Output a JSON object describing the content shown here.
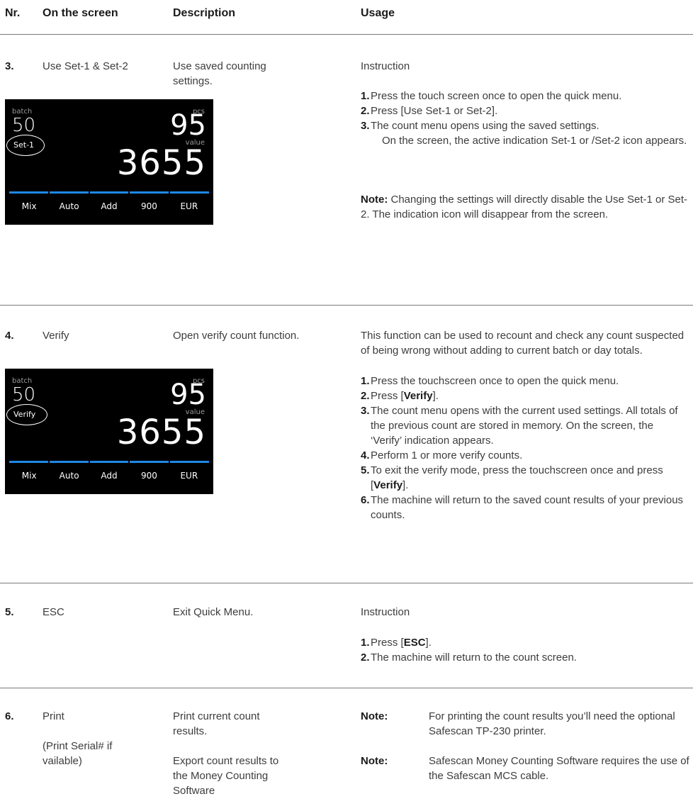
{
  "headers": {
    "nr": "Nr.",
    "screen": "On the screen",
    "description": "Description",
    "usage": "Usage"
  },
  "rows": [
    {
      "nr": "3.",
      "screen_name": "Use Set-1 & Set-2",
      "description": "Use saved counting settings.",
      "usage_title": "Instruction",
      "steps": [
        {
          "n": "1.",
          "text": "Press the touch screen once to open the quick menu."
        },
        {
          "n": "2.",
          "text": "Press [Use Set-1 or Set-2]."
        },
        {
          "n": "3.",
          "text_a": "The count menu opens using the saved settings.",
          "text_b": "On the screen, the active indication Set-1 or /Set-2 icon appears."
        }
      ],
      "note_label": "Note:",
      "note_text": "Changing the settings will directly disable the Use Set-1 or Set-2. The indication icon will disappear from the screen.",
      "display": {
        "batch_label": "batch",
        "batch": "50",
        "pcs_label": "pcs",
        "pcs": "95",
        "value_label": "value",
        "value": "3655",
        "indicator": "Set-1",
        "tabs": [
          "Mix",
          "Auto",
          "Add",
          "900",
          "EUR"
        ]
      }
    },
    {
      "nr": "4.",
      "screen_name": "Verify",
      "description": "Open verify count function.",
      "intro": "This function can be used to recount and check any count suspected of being wrong without adding to current batch or day totals.",
      "steps": [
        {
          "n": "1.",
          "text": "Press the touchscreen once to open the quick menu."
        },
        {
          "n": "2.",
          "pre": "Press [",
          "bold": "Verify",
          "post": "]."
        },
        {
          "n": "3.",
          "text": "The count menu opens with the current used settings. All totals of the previous count are stored in memory. On the screen, the ‘Verify’ indication appears."
        },
        {
          "n": "4.",
          "text": "Perform 1 or more verify counts."
        },
        {
          "n": "5.",
          "pre": "To exit the verify mode, press the touchscreen once and press [",
          "bold": "Verify",
          "post": "]."
        },
        {
          "n": "6.",
          "text": "The machine will return to the saved count results of your previous counts."
        }
      ],
      "display": {
        "batch_label": "batch",
        "batch": "50",
        "pcs_label": "pcs",
        "pcs": "95",
        "value_label": "value",
        "value": "3655",
        "indicator": "Verify",
        "tabs": [
          "Mix",
          "Auto",
          "Add",
          "900",
          "EUR"
        ]
      }
    },
    {
      "nr": "5.",
      "screen_name": "ESC",
      "description": "Exit Quick Menu.",
      "usage_title": "Instruction",
      "steps": [
        {
          "n": "1.",
          "pre": "Press [",
          "bold": "ESC",
          "post": "]."
        },
        {
          "n": "2.",
          "text": "The machine will return to the count screen."
        }
      ]
    },
    {
      "nr": "6.",
      "screen_name": "Print",
      "screen_sub": "(Print Serial# if vailable)",
      "description": "Print current count results.",
      "description_2": "Export count results to the Money Counting Software",
      "notes": [
        {
          "label": "Note:",
          "text": "For printing the count results you’ll need the optional Safescan TP-230 printer."
        },
        {
          "label": "Note:",
          "text": "Safescan Money Counting Software requires the use of the Safescan MCS cable."
        }
      ]
    }
  ]
}
